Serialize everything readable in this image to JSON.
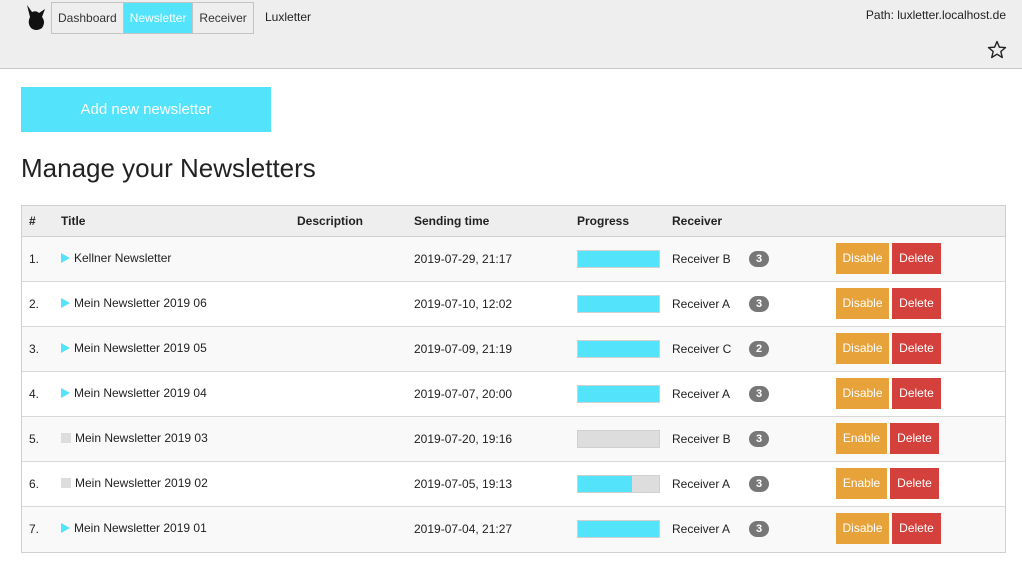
{
  "header": {
    "nav": [
      {
        "label": "Dashboard",
        "active": false
      },
      {
        "label": "Newsletter",
        "active": true
      },
      {
        "label": "Receiver",
        "active": false
      }
    ],
    "brand": "Luxletter",
    "path": "Path: luxletter.localhost.de",
    "logo_icon": "cat-icon",
    "favorite_icon": "star-outline-icon"
  },
  "main": {
    "add_button": "Add new newsletter",
    "title": "Manage your Newsletters"
  },
  "table": {
    "columns": [
      "#",
      "Title",
      "Description",
      "Sending time",
      "Progress",
      "Receiver"
    ],
    "rows": [
      {
        "num": "1.",
        "icon": "play-icon",
        "title": "Kellner Newsletter",
        "description": "",
        "time": "2019-07-29, 21:17",
        "progress": 100,
        "receiver": "Receiver B",
        "count": "3",
        "toggle": "Disable",
        "delete": "Delete"
      },
      {
        "num": "2.",
        "icon": "play-icon",
        "title": "Mein Newsletter 2019 06",
        "description": "",
        "time": "2019-07-10, 12:02",
        "progress": 100,
        "receiver": "Receiver A",
        "count": "3",
        "toggle": "Disable",
        "delete": "Delete"
      },
      {
        "num": "3.",
        "icon": "play-icon",
        "title": "Mein Newsletter 2019 05",
        "description": "",
        "time": "2019-07-09, 21:19",
        "progress": 100,
        "receiver": "Receiver C",
        "count": "2",
        "toggle": "Disable",
        "delete": "Delete"
      },
      {
        "num": "4.",
        "icon": "play-icon",
        "title": "Mein Newsletter 2019 04",
        "description": "",
        "time": "2019-07-07, 20:00",
        "progress": 100,
        "receiver": "Receiver A",
        "count": "3",
        "toggle": "Disable",
        "delete": "Delete"
      },
      {
        "num": "5.",
        "icon": "stop-icon",
        "title": "Mein Newsletter 2019 03",
        "description": "",
        "time": "2019-07-20, 19:16",
        "progress": 0,
        "receiver": "Receiver B",
        "count": "3",
        "toggle": "Enable",
        "delete": "Delete"
      },
      {
        "num": "6.",
        "icon": "stop-icon",
        "title": "Mein Newsletter 2019 02",
        "description": "",
        "time": "2019-07-05, 19:13",
        "progress": 67,
        "receiver": "Receiver A",
        "count": "3",
        "toggle": "Enable",
        "delete": "Delete"
      },
      {
        "num": "7.",
        "icon": "play-icon",
        "title": "Mein Newsletter 2019 01",
        "description": "",
        "time": "2019-07-04, 21:27",
        "progress": 100,
        "receiver": "Receiver A",
        "count": "3",
        "toggle": "Disable",
        "delete": "Delete"
      }
    ]
  },
  "colors": {
    "accent": "#53e3fb",
    "warning": "#e8a23a",
    "danger": "#d4403c",
    "badge": "#777777"
  }
}
